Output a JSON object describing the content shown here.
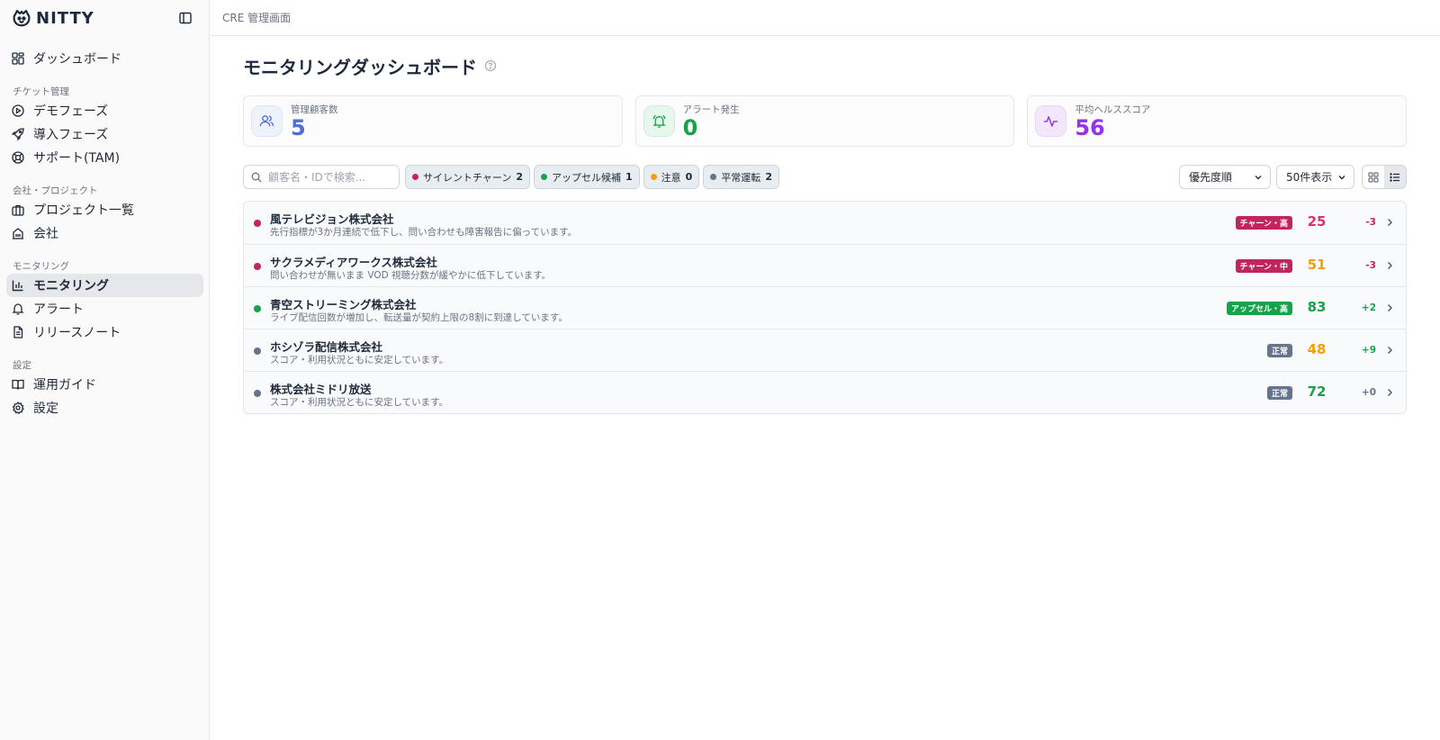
{
  "app": {
    "brand": "NITTY",
    "breadcrumb": "CRE 管理画面"
  },
  "sidebar": {
    "top_item": {
      "label": "ダッシュボード",
      "icon": "dashboard-grid-icon"
    },
    "sections": [
      {
        "title": "チケット管理",
        "items": [
          {
            "label": "デモフェーズ",
            "icon": "play-circle-icon"
          },
          {
            "label": "導入フェーズ",
            "icon": "rocket-icon"
          },
          {
            "label": "サポート(TAM)",
            "icon": "lifebuoy-icon"
          }
        ]
      },
      {
        "title": "会社・プロジェクト",
        "items": [
          {
            "label": "プロジェクト一覧",
            "icon": "briefcase-icon"
          },
          {
            "label": "会社",
            "icon": "building-icon"
          }
        ]
      },
      {
        "title": "モニタリング",
        "items": [
          {
            "label": "モニタリング",
            "icon": "bar-chart-icon",
            "active": true
          },
          {
            "label": "アラート",
            "icon": "bell-icon"
          },
          {
            "label": "リリースノート",
            "icon": "file-text-icon"
          }
        ]
      },
      {
        "title": "設定",
        "items": [
          {
            "label": "運用ガイド",
            "icon": "book-icon"
          },
          {
            "label": "設定",
            "icon": "gear-icon"
          }
        ]
      }
    ]
  },
  "page": {
    "title": "モニタリングダッシュボード"
  },
  "stats": [
    {
      "label": "管理顧客数",
      "value": "5",
      "color": "#4f6fd8",
      "bg": "#eef2fb",
      "icon": "users-icon"
    },
    {
      "label": "アラート発生",
      "value": "0",
      "color": "#16a34a",
      "bg": "#e8f7ee",
      "icon": "bell-ring-icon"
    },
    {
      "label": "平均ヘルススコア",
      "value": "56",
      "color": "#9333ea",
      "bg": "#f3e8fb",
      "icon": "activity-icon"
    }
  ],
  "toolbar": {
    "search_placeholder": "顧客名・IDで検索...",
    "chips": [
      {
        "label": "サイレントチャーン",
        "count": "2",
        "color": "#c2255c"
      },
      {
        "label": "アップセル候補",
        "count": "1",
        "color": "#16a34a"
      },
      {
        "label": "注意",
        "count": "0",
        "color": "#f59e0b"
      },
      {
        "label": "平常運転",
        "count": "2",
        "color": "#64748b"
      }
    ],
    "sort_value": "優先度順",
    "count_value": "50件表示"
  },
  "customers": [
    {
      "name": "風テレビジョン株式会社",
      "desc": "先行指標が3か月連続で低下し、問い合わせも障害報告に偏っています。",
      "badge": "チャーン・高",
      "badge_color": "#c2255c",
      "score": "25",
      "score_color": "#d6336c",
      "delta": "-3",
      "delta_color": "#c2255c",
      "dot_color": "#c2255c"
    },
    {
      "name": "サクラメディアワークス株式会社",
      "desc": "問い合わせが無いまま VOD 視聴分数が緩やかに低下しています。",
      "badge": "チャーン・中",
      "badge_color": "#c2255c",
      "score": "51",
      "score_color": "#f59e0b",
      "delta": "-3",
      "delta_color": "#c2255c",
      "dot_color": "#c2255c"
    },
    {
      "name": "青空ストリーミング株式会社",
      "desc": "ライブ配信回数が増加し、転送量が契約上限の8割に到達しています。",
      "badge": "アップセル・高",
      "badge_color": "#16a34a",
      "score": "83",
      "score_color": "#16a34a",
      "delta": "+2",
      "delta_color": "#16a34a",
      "dot_color": "#16a34a"
    },
    {
      "name": "ホシゾラ配信株式会社",
      "desc": "スコア・利用状況ともに安定しています。",
      "badge": "正常",
      "badge_color": "#64748b",
      "score": "48",
      "score_color": "#f59e0b",
      "delta": "+9",
      "delta_color": "#16a34a",
      "dot_color": "#64748b"
    },
    {
      "name": "株式会社ミドリ放送",
      "desc": "スコア・利用状況ともに安定しています。",
      "badge": "正常",
      "badge_color": "#64748b",
      "score": "72",
      "score_color": "#16a34a",
      "delta": "+0",
      "delta_color": "#64748b",
      "dot_color": "#64748b"
    }
  ]
}
